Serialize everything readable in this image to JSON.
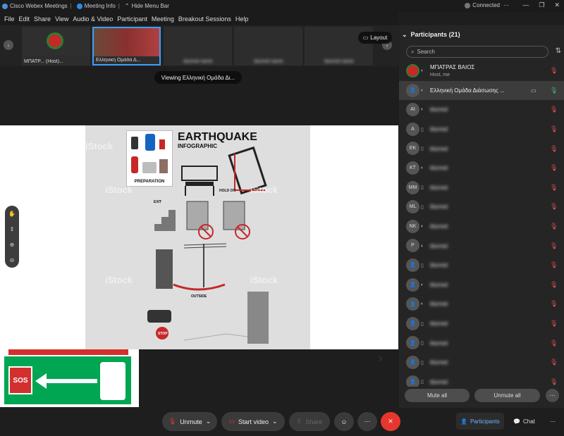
{
  "titlebar": {
    "app": "Cisco Webex Meetings",
    "meeting_info": "Meeting Info",
    "hide_menu": "Hide Menu Bar",
    "connected": "Connected"
  },
  "menu": [
    "File",
    "Edit",
    "Share",
    "View",
    "Audio & Video",
    "Participant",
    "Meeting",
    "Breakout Sessions",
    "Help"
  ],
  "strip": {
    "thumbs": [
      {
        "label": "ΜΠΑΤΡ... (Host)..."
      },
      {
        "label": "Ελληνική Ομάδα Δ..."
      },
      {
        "label": "blurred name"
      },
      {
        "label": "blurred name"
      },
      {
        "label": "blurred name"
      }
    ],
    "layout": "Layout",
    "viewing": "Viewing Ελληνική Ομάδα Δι..."
  },
  "share": {
    "title": "EARTHQUAKE",
    "subtitle": "INFOGRAPHIC",
    "prep": "PREPARATION",
    "hold": "HOLD ON",
    "exit": "EXIT",
    "outside": "OUTSIDE",
    "stop": "STOP",
    "watermark": "iStock",
    "sos": "SOS"
  },
  "panel": {
    "title": "Participants (21)",
    "search_placeholder": "Search",
    "participants": [
      {
        "initials": "",
        "name": "ΜΠΑΤΡΑΣ ΒΑΙΟΣ",
        "sub": "Host, me",
        "mic": "muted"
      },
      {
        "initials": "",
        "name": "Ελληνική Ομάδα Διάσωσης ...",
        "sub": "",
        "mic": "on"
      },
      {
        "initials": "AI",
        "name": "blurred",
        "sub": "",
        "mic": "muted"
      },
      {
        "initials": "A",
        "name": "blurred",
        "sub": "",
        "mic": "muted"
      },
      {
        "initials": "EK",
        "name": "blurred",
        "sub": "",
        "mic": "muted"
      },
      {
        "initials": "KT",
        "name": "blurred",
        "sub": "",
        "mic": "muted"
      },
      {
        "initials": "MM",
        "name": "blurred",
        "sub": "",
        "mic": "muted"
      },
      {
        "initials": "ML",
        "name": "blurred",
        "sub": "",
        "mic": "muted"
      },
      {
        "initials": "NK",
        "name": "blurred",
        "sub": "",
        "mic": "muted"
      },
      {
        "initials": "P",
        "name": "blurred",
        "sub": "",
        "mic": "muted"
      },
      {
        "initials": "",
        "name": "blurred",
        "sub": "",
        "mic": "muted"
      },
      {
        "initials": "",
        "name": "blurred",
        "sub": "",
        "mic": "muted"
      },
      {
        "initials": "",
        "name": "blurred",
        "sub": "",
        "mic": "muted"
      },
      {
        "initials": "",
        "name": "blurred",
        "sub": "",
        "mic": "muted"
      },
      {
        "initials": "",
        "name": "blurred",
        "sub": "",
        "mic": "muted"
      },
      {
        "initials": "",
        "name": "blurred",
        "sub": "",
        "mic": "muted"
      },
      {
        "initials": "",
        "name": "blurred",
        "sub": "",
        "mic": "muted"
      }
    ],
    "mute_all": "Mute all",
    "unmute_all": "Unmute all"
  },
  "controls": {
    "unmute": "Unmute",
    "start_video": "Start video",
    "share": "Share",
    "participants": "Participants",
    "chat": "Chat"
  },
  "colors": {
    "accent": "#6ab4ff",
    "end": "#e6372e",
    "muted": "#d9534f",
    "on": "#3cb371"
  }
}
